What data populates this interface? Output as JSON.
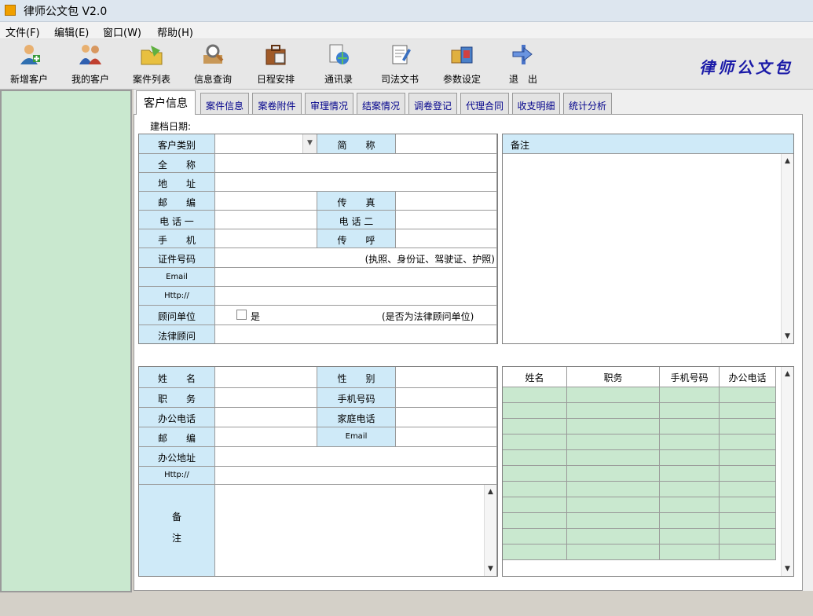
{
  "app": {
    "title": "律师公文包 V2.0"
  },
  "menu": [
    "文件(F)",
    "编辑(E)",
    "窗口(W)",
    "帮助(H)"
  ],
  "toolbar": [
    {
      "label": "新增客户",
      "icon": "add-client-icon"
    },
    {
      "label": "我的客户",
      "icon": "my-clients-icon"
    },
    {
      "label": "案件列表",
      "icon": "case-list-icon"
    },
    {
      "label": "信息查询",
      "icon": "info-query-icon"
    },
    {
      "label": "日程安排",
      "icon": "schedule-icon"
    },
    {
      "label": "通讯录",
      "icon": "address-book-icon"
    },
    {
      "label": "司法文书",
      "icon": "judicial-document-icon"
    },
    {
      "label": "参数设定",
      "icon": "settings-icon"
    },
    {
      "label": "退　出",
      "icon": "exit-icon"
    }
  ],
  "brand": "律师公文包",
  "tabs": [
    "客户信息",
    "案件信息",
    "案卷附件",
    "审理情况",
    "结案情况",
    "调卷登记",
    "代理合同",
    "收支明细",
    "统计分析"
  ],
  "client": {
    "date_label": "建档日期:",
    "type_label": "客户类别",
    "short_name_label": "简　　称",
    "full_name_label": "全　　称",
    "address_label": "地　　址",
    "postcode_label": "邮　　编",
    "fax_label": "传　　真",
    "phone1_label": "电 话 一",
    "phone2_label": "电 话 二",
    "mobile_label": "手　　机",
    "pager_label": "传　　呼",
    "id_label": "证件号码",
    "id_hint": "(执照、身份证、驾驶证、护照)",
    "email_label": "Email",
    "http_label": "Http://",
    "advisor_unit_label": "顾问单位",
    "advisor_unit_check": "是",
    "advisor_unit_hint": "(是否为法律顾问单位)",
    "legal_advisor_label": "法律顾问",
    "remarks_label": "备注"
  },
  "contact": {
    "name_label": "姓　　名",
    "gender_label": "性　　别",
    "position_label": "职　　务",
    "mobile_label": "手机号码",
    "office_phone_label": "办公电话",
    "home_phone_label": "家庭电话",
    "postcode_label": "邮　　编",
    "email_label": "Email",
    "office_address_label": "办公地址",
    "http_label": "Http://",
    "remarks_label_1": "备",
    "remarks_label_2": "注"
  },
  "contacts_table": {
    "columns": [
      "姓名",
      "职务",
      "手机号码",
      "办公电话"
    ],
    "rows": 11
  }
}
